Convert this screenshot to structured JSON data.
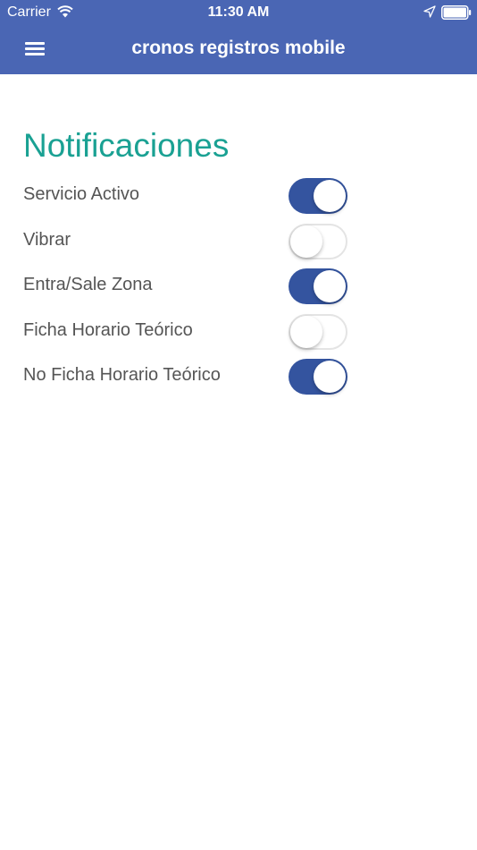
{
  "status_bar": {
    "carrier": "Carrier",
    "time": "11:30 AM",
    "icons": [
      "wifi-icon",
      "location-icon",
      "battery-icon"
    ]
  },
  "navbar": {
    "title": "cronos registros mobile",
    "menu_icon": "menu-icon"
  },
  "colors": {
    "header": "#4a66b4",
    "accent": "#1aa193",
    "toggle_on": "#34549f"
  },
  "section": {
    "title": "Notificaciones"
  },
  "settings": [
    {
      "label": "Servicio Activo",
      "on": true
    },
    {
      "label": "Vibrar",
      "on": false
    },
    {
      "label": "Entra/Sale Zona",
      "on": true
    },
    {
      "label": "Ficha Horario Teórico",
      "on": false
    },
    {
      "label": "No Ficha Horario Teórico",
      "on": true
    }
  ]
}
